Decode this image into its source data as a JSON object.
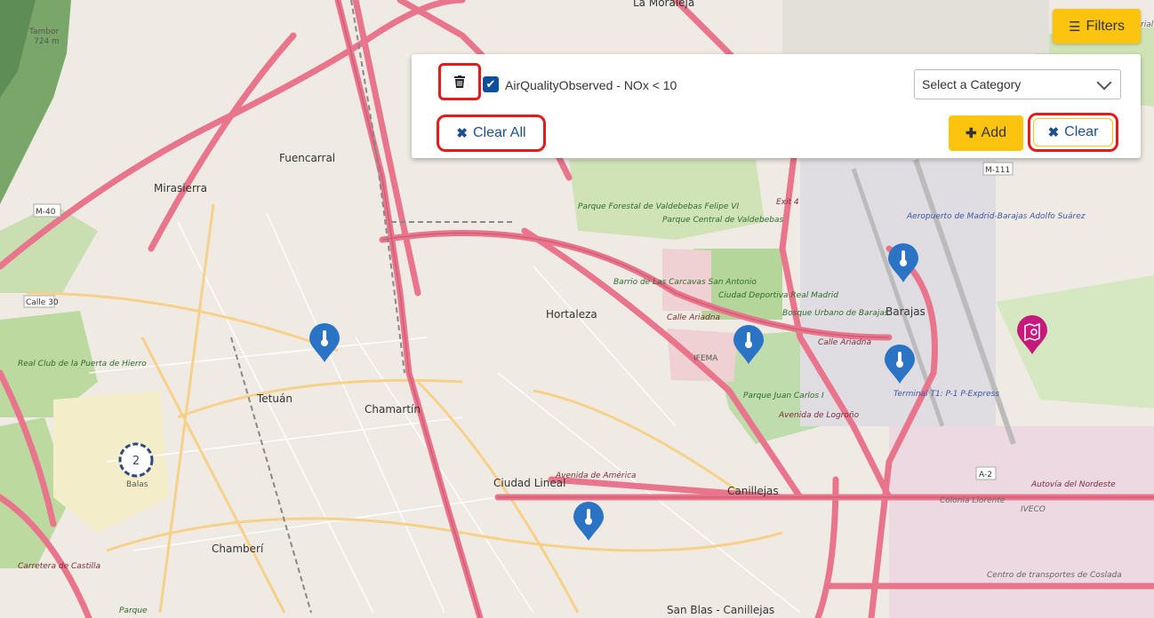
{
  "toolbar": {
    "filters_label": "Filters"
  },
  "filter_panel": {
    "filter_label": "AirQualityObserved - NOx < 10",
    "category_select": "Select a Category",
    "clear_all_label": "Clear All",
    "add_label": "Add",
    "clear_label": "Clear"
  },
  "map": {
    "labels": {
      "la_moraleja": "La Moraleja",
      "tambor": "Tambor",
      "tambor_elev": "724 m",
      "fuencarral": "Fuencarral",
      "mirasierra": "Mirasierra",
      "hortaleza": "Hortaleza",
      "tetuan": "Tetuán",
      "chamartin": "Chamartín",
      "ciudad_lineal": "Ciudad Lineal",
      "canillejas": "Canillejas",
      "chamberi": "Chamberí",
      "barajas": "Barajas",
      "san_blas": "San Blas - Canillejas",
      "ifema": "IFEMA",
      "balas": "Balas",
      "parque_forestal": "Parque Forestal de Valdebebas Felipe VI",
      "parque_central": "Parque Central de Valdebebas",
      "barrio_carcavas": "Barrio de Las Carcavas San Antonio",
      "ciudad_deportiva": "Ciudad Deportiva Real Madrid",
      "bosque_urbano": "Bosque Urbano de Barajas",
      "parque_jc": "Parque Juan Carlos I",
      "aeropuerto": "Aeropuerto de Madrid-Barajas Adolfo Suárez",
      "real_club": "Real Club de la Puerta de Hierro",
      "terminal": "Terminal T1: P-1 P-Express",
      "colonia": "Colonia Llorente",
      "iveco": "IVECO",
      "centro_transportes": "Centro de transportes de Coslada",
      "calle_ariadna_1": "Calle Ariadna",
      "calle_ariadna_2": "Calle Ariadna",
      "avenida_america": "Avenida de América",
      "autovia_nordeste": "Autovía del Nordeste",
      "avenida_logrono": "Avenida de Logroño",
      "a2": "A-2",
      "m40": "M-40",
      "m111": "M-111",
      "calle30": "Calle 30",
      "carretera_castilla": "Carretera de Castilla",
      "parque_bottom": "Parque",
      "industrial": "Industrial",
      "exit4": "Exit 4",
      "cluster_count": "2"
    },
    "icons": {
      "marker": "thermometer-marker-icon",
      "poi": "map-search-poi-icon",
      "cluster": "cluster-icon"
    }
  },
  "colors": {
    "accent_yellow": "#fcc40e",
    "marker_blue": "#2a73c5",
    "poi_magenta": "#c7197b",
    "highlight_red": "#e31b1b",
    "link_blue": "#1d4f8c"
  }
}
